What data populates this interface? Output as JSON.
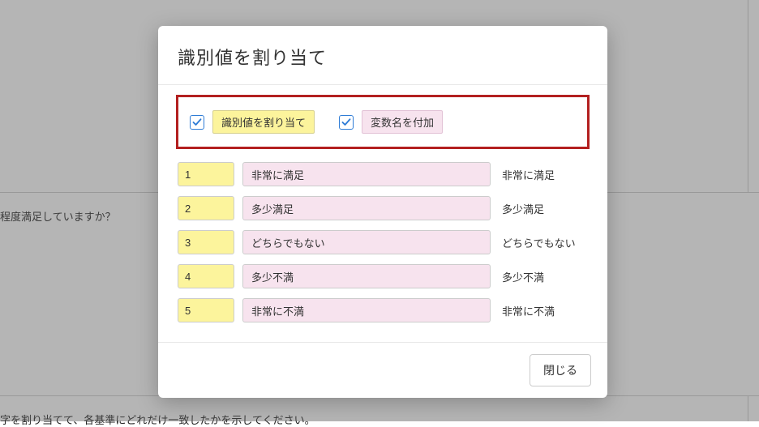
{
  "background": {
    "question": "程度満足していますか？",
    "instruction": "字を割り当てて、各基準にどれだけ一致したかを示してください。",
    "truncated1": "い"
  },
  "modal": {
    "title": "識別値を割り当て",
    "assignIdLabel": "識別値を割り当て",
    "addVarLabel": "変数名を付加",
    "closeLabel": "閉じる",
    "rows": [
      {
        "id": "1",
        "var": "非常に満足",
        "orig": "非常に満足"
      },
      {
        "id": "2",
        "var": "多少満足",
        "orig": "多少満足"
      },
      {
        "id": "3",
        "var": "どちらでもない",
        "orig": "どちらでもない"
      },
      {
        "id": "4",
        "var": "多少不満",
        "orig": "多少不満"
      },
      {
        "id": "5",
        "var": "非常に不満",
        "orig": "非常に不満"
      }
    ]
  }
}
